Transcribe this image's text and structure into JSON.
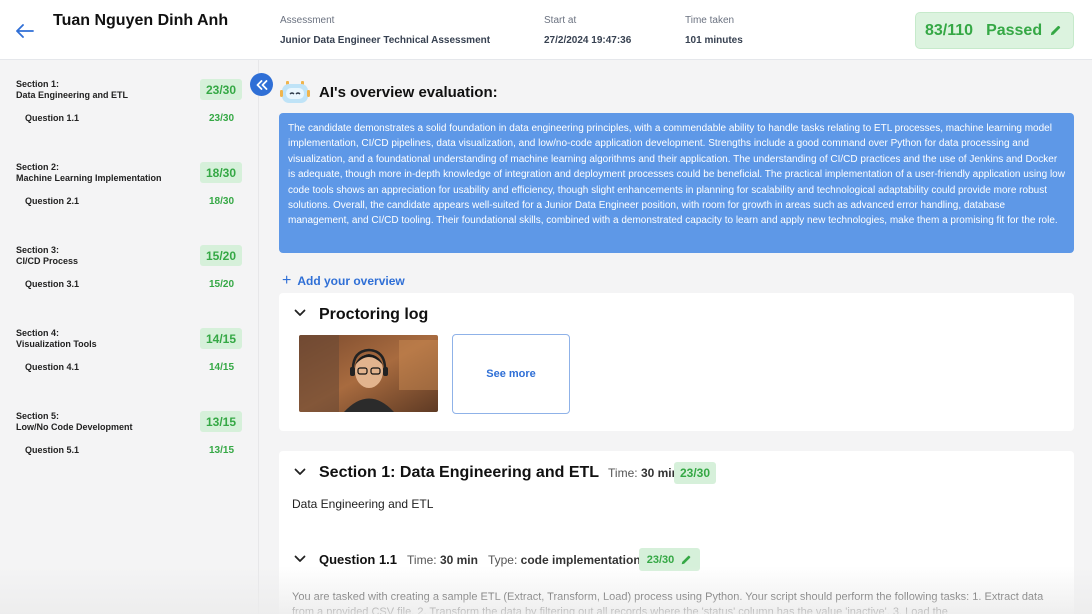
{
  "header": {
    "candidate_name": "Tuan Nguyen Dinh Anh",
    "assessment_label": "Assessment",
    "assessment_value": "Junior Data Engineer Technical Assessment",
    "start_label": "Start at",
    "start_value": "27/2/2024 19:47:36",
    "time_label": "Time taken",
    "time_value": "101 minutes",
    "score": "83/110",
    "status": "Passed"
  },
  "sidebar": {
    "sections": [
      {
        "label": "Section 1:",
        "name": "Data Engineering and ETL",
        "score": "23/30",
        "question": "Question 1.1",
        "question_score": "23/30"
      },
      {
        "label": "Section 2:",
        "name": "Machine Learning Implementation",
        "score": "18/30",
        "question": "Question 2.1",
        "question_score": "18/30"
      },
      {
        "label": "Section 3:",
        "name": "CI/CD Process",
        "score": "15/20",
        "question": "Question 3.1",
        "question_score": "15/20"
      },
      {
        "label": "Section 4:",
        "name": "Visualization Tools",
        "score": "14/15",
        "question": "Question 4.1",
        "question_score": "14/15"
      },
      {
        "label": "Section 5:",
        "name": "Low/No Code Development",
        "score": "13/15",
        "question": "Question 5.1",
        "question_score": "13/15"
      }
    ]
  },
  "main": {
    "ai_title": "AI's overview evaluation:",
    "overview_text": "The candidate demonstrates a solid foundation in data engineering principles, with a commendable ability to handle tasks relating to ETL processes, machine learning model implementation, CI/CD pipelines, data visualization, and low/no-code application development. Strengths include a good command over Python for data processing and visualization, and a foundational understanding of machine learning algorithms and their application. The understanding of CI/CD practices and the use of Jenkins and Docker is adequate, though more in-depth knowledge of integration and deployment processes could be beneficial. The practical implementation of a user-friendly application using low code tools shows an appreciation for usability and efficiency, though slight enhancements in planning for scalability and technological adaptability could provide more robust solutions. Overall, the candidate appears well-suited for a Junior Data Engineer position, with room for growth in areas such as advanced error handling, database management, and CI/CD tooling. Their foundational skills, combined with a demonstrated capacity to learn and apply new technologies, make them a promising fit for the role.",
    "add_overview": "Add your overview",
    "proctoring_title": "Proctoring log",
    "see_more": "See more",
    "section1": {
      "title": "Section 1: Data Engineering and ETL",
      "time_label": "Time:",
      "time_value": "30 min",
      "score": "23/30",
      "description": "Data Engineering and ETL",
      "question": {
        "title": "Question 1.1",
        "time_label": "Time:",
        "time_value": "30 min",
        "type_label": "Type:",
        "type_value": "code implementation",
        "score": "23/30",
        "body": "You are tasked with creating a sample ETL (Extract, Transform, Load) process using Python. Your script should perform the following tasks: 1. Extract data from a provided CSV file. 2. Transform the data by filtering out all records where the 'status' column has the value 'inactive'. 3. Load the"
      }
    }
  },
  "colors": {
    "accent": "#2f6fd6",
    "success": "#35a845",
    "success_bg": "#d6f0da",
    "overview_bg": "#5e98e7"
  }
}
